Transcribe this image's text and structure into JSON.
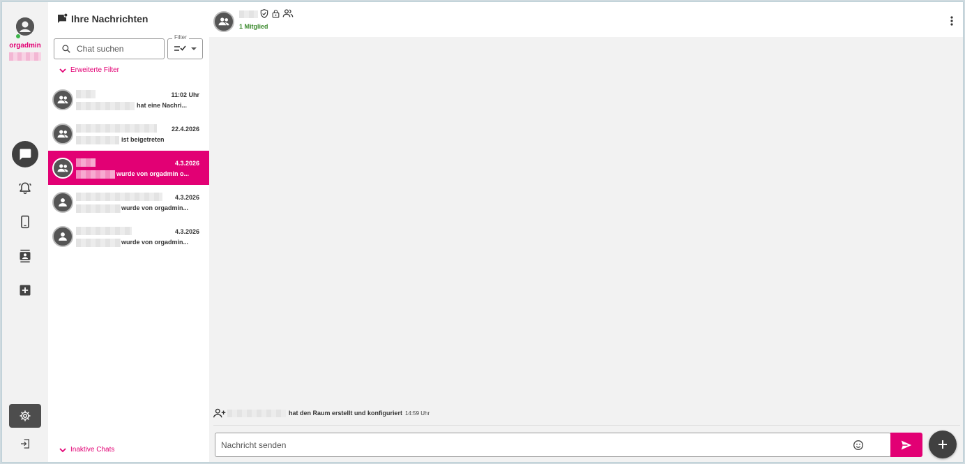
{
  "rail": {
    "username": "orgadmin",
    "nav": [
      {
        "name": "chats",
        "icon": "chat-bubble-icon",
        "active": true
      },
      {
        "name": "alarms",
        "icon": "alarm-bell-icon",
        "active": false
      },
      {
        "name": "devices",
        "icon": "smartphone-icon",
        "active": false
      },
      {
        "name": "contacts",
        "icon": "contacts-icon",
        "active": false
      },
      {
        "name": "new-chat",
        "icon": "add-box-icon",
        "active": false
      }
    ],
    "settings_icon": "gear-icon",
    "logout_icon": "logout-icon"
  },
  "list": {
    "title": "Ihre Nachrichten",
    "search_placeholder": "Chat suchen",
    "filter_label": "Filter",
    "advanced_filter": "Erweiterte Filter",
    "inactive_chats": "Inaktive Chats",
    "chats": [
      {
        "type": "group",
        "time": "11:02 Uhr",
        "preview": "hat eine Nachri...",
        "selected": false
      },
      {
        "type": "group",
        "time": "22.4.2026",
        "preview": "ist beigetreten",
        "selected": false
      },
      {
        "type": "group",
        "time": "4.3.2026",
        "preview": "wurde von orgadmin o...",
        "selected": true
      },
      {
        "type": "person",
        "time": "4.3.2026",
        "preview": "wurde von orgadmin...",
        "selected": false
      },
      {
        "type": "person",
        "time": "4.3.2026",
        "preview": "wurde von orgadmin...",
        "selected": false
      }
    ]
  },
  "main": {
    "members": "1 Mitglied",
    "system_message": "hat den Raum erstellt und konfiguriert",
    "system_time": "14:59 Uhr",
    "composer_placeholder": "Nachricht senden"
  },
  "colors": {
    "accent": "#e20074",
    "dark": "#404040",
    "online": "#3cb54a",
    "members_green": "#3c8a2e"
  }
}
